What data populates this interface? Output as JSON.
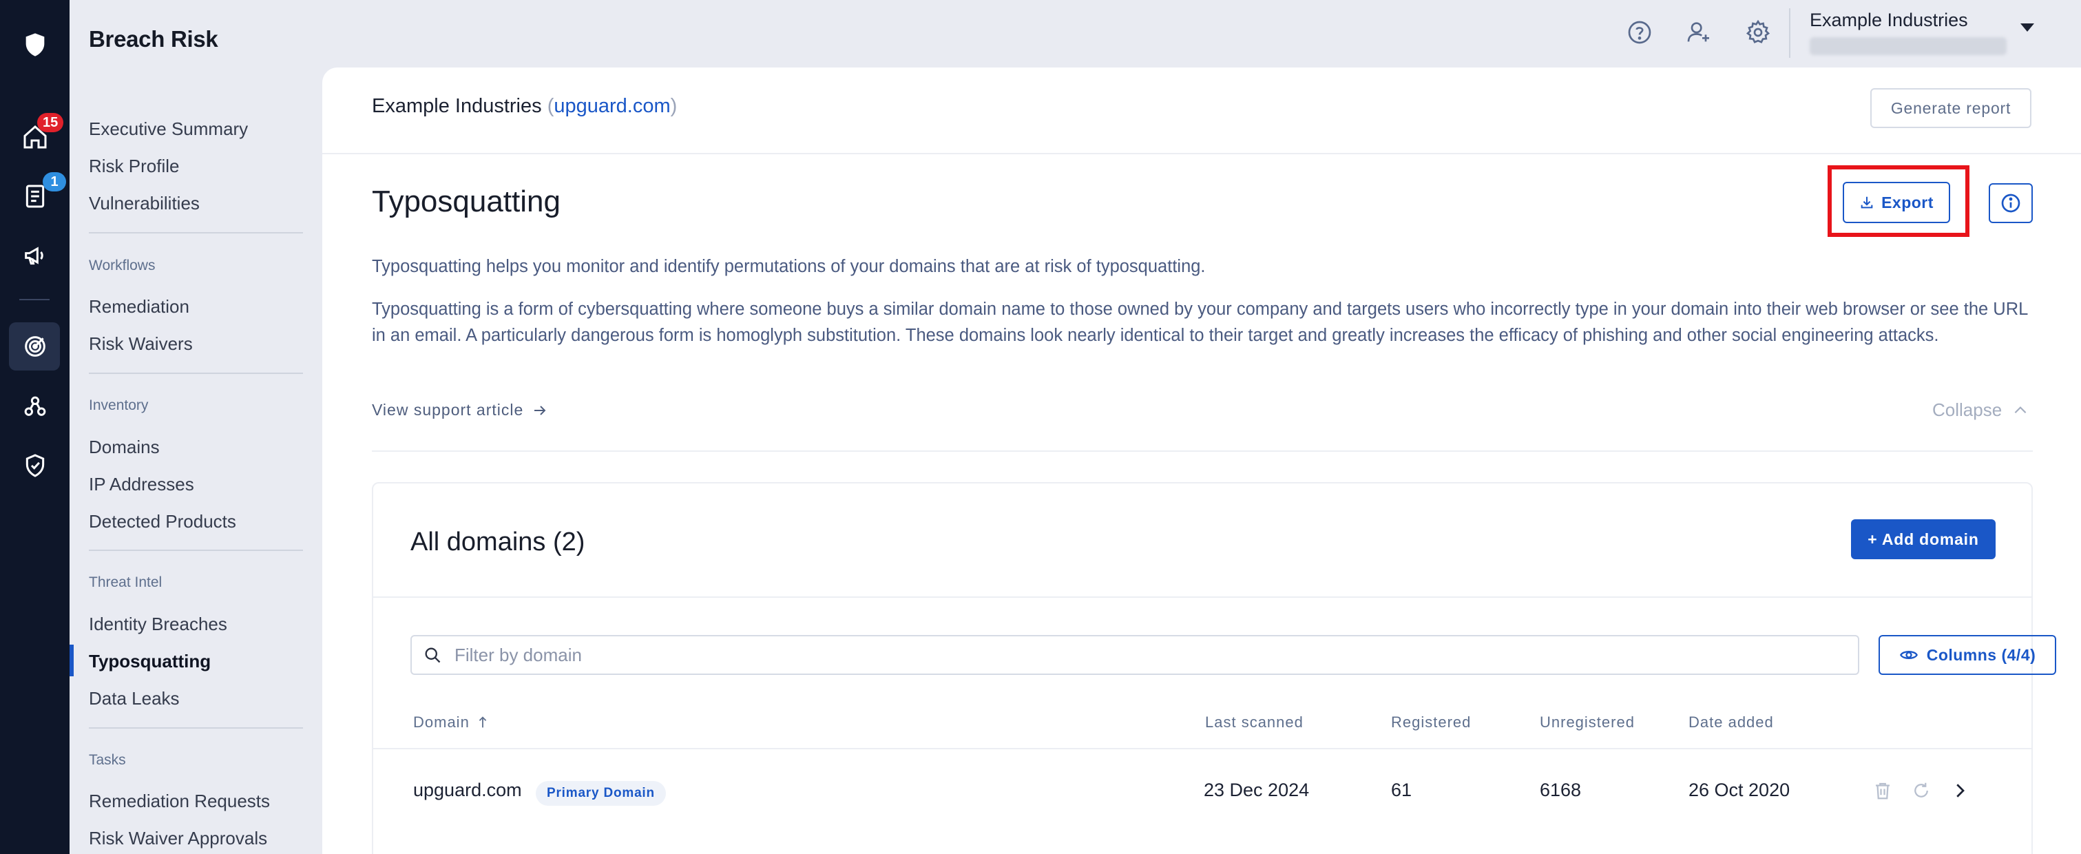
{
  "app": {
    "title": "Breach Risk"
  },
  "rail": {
    "badges": {
      "home": "15",
      "reports": "1"
    },
    "colors": {
      "home_badge": "#e0212b",
      "reports_badge": "#2f8fe0"
    }
  },
  "nav": {
    "top_items": [
      "Executive Summary",
      "Risk Profile",
      "Vulnerabilities"
    ],
    "groups": [
      {
        "label": "Workflows",
        "items": [
          "Remediation",
          "Risk Waivers"
        ]
      },
      {
        "label": "Inventory",
        "items": [
          "Domains",
          "IP Addresses",
          "Detected Products"
        ]
      },
      {
        "label": "Threat Intel",
        "items": [
          "Identity Breaches",
          "Typosquatting",
          "Data Leaks"
        ]
      },
      {
        "label": "Tasks",
        "items": [
          "Remediation Requests",
          "Risk Waiver Approvals"
        ]
      }
    ],
    "active_item": "Typosquatting"
  },
  "topbar": {
    "org_name": "Example Industries",
    "icons": [
      "help-icon",
      "add-user-icon",
      "settings-icon"
    ]
  },
  "header": {
    "org": "Example Industries",
    "domain": "upguard.com",
    "generate_report_label": "Generate report"
  },
  "page": {
    "title": "Typosquatting",
    "export_label": "Export",
    "intro": "Typosquatting helps you monitor and identify permutations of your domains that are at risk of typosquatting.",
    "description": "Typosquatting is a form of cybersquatting where someone buys a similar domain name to those owned by your company and targets users who incorrectly type in your domain into their web browser or see the URL in an email. A particularly dangerous form is homoglyph substitution. These domains look nearly identical to their target and greatly increases the efficacy of phishing and other social engineering attacks.",
    "support_link": "View support article",
    "collapse_label": "Collapse"
  },
  "card": {
    "title": "All domains (2)",
    "add_button": "+ Add domain",
    "search_placeholder": "Filter by domain",
    "columns_button": "Columns (4/4)",
    "headers": {
      "domain": "Domain",
      "last_scanned": "Last scanned",
      "registered": "Registered",
      "unregistered": "Unregistered",
      "date_added": "Date added"
    },
    "rows": [
      {
        "domain": "upguard.com",
        "badge": "Primary Domain",
        "last_scanned": "23 Dec 2024",
        "registered": "61",
        "unregistered": "6168",
        "date_added": "26 Oct 2020"
      }
    ]
  },
  "colors": {
    "accent": "#1a57c7",
    "highlight": "#e8141a",
    "rail_bg": "#0e1629"
  }
}
